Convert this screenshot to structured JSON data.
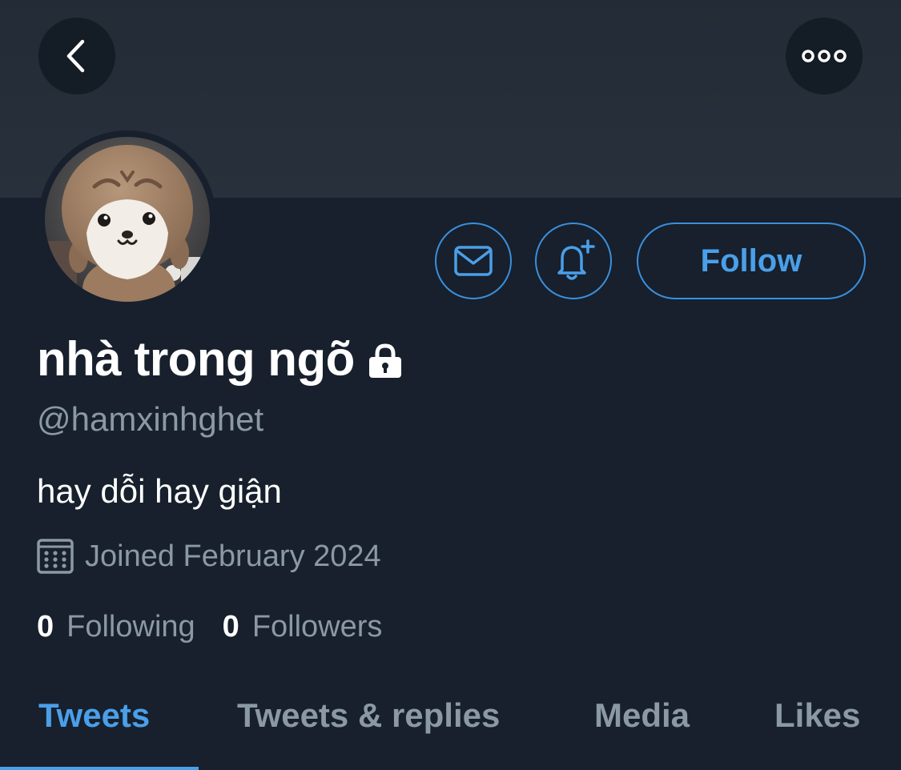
{
  "profile": {
    "display_name": "nhà trong ngõ",
    "handle": "@hamxinhghet",
    "bio": "hay dỗi hay giận",
    "joined": "Joined February 2024",
    "following_count": "0",
    "following_label": "Following",
    "followers_count": "0",
    "followers_label": "Followers",
    "protected": true
  },
  "actions": {
    "follow_label": "Follow",
    "message_icon": "mail-icon",
    "notify_icon": "bell-plus-icon",
    "back_icon": "chevron-left-icon",
    "more_icon": "more-horizontal-icon"
  },
  "tabs": [
    {
      "label": "Tweets",
      "active": true
    },
    {
      "label": "Tweets & replies",
      "active": false
    },
    {
      "label": "Media",
      "active": false
    },
    {
      "label": "Likes",
      "active": false
    }
  ],
  "colors": {
    "background": "#17202c",
    "banner": "#262f3a",
    "accent": "#4a9fe9",
    "secondary_text": "#8b98a5",
    "primary_text": "#ffffff"
  }
}
